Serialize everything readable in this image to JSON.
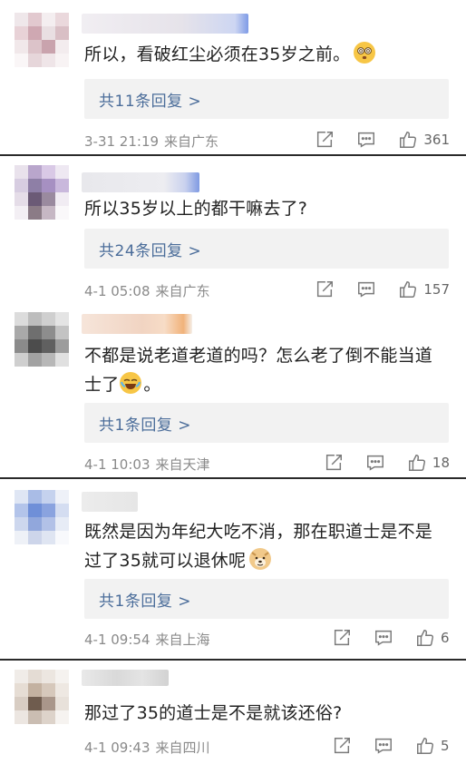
{
  "comments": [
    {
      "text": "所以，看破红尘必须在35岁之前。",
      "emoji": "dizzy-face-emoji",
      "replies": "共11条回复 >",
      "time": "3-31 21:19",
      "source": "来自广东",
      "likes": "361"
    },
    {
      "text": "所以35岁以上的都干嘛去了?",
      "replies": "共24条回复 >",
      "time": "4-1 05:08",
      "source": "来自广东",
      "likes": "157"
    },
    {
      "text_line1": "不都是说老道老道的吗？怎么老了倒不能当道",
      "text_line2": "士了",
      "text_line2_end": "。",
      "emoji": "laugh-cry-emoji",
      "replies": "共1条回复 >",
      "time": "4-1 10:03",
      "source": "来自天津",
      "likes": "18"
    },
    {
      "text_line1": "既然是因为年纪大吃不消，那在职道士是不是",
      "text_line2": "过了35就可以退休呢",
      "emoji": "doge-emoji",
      "replies": "共1条回复 >",
      "time": "4-1 09:54",
      "source": "来自上海",
      "likes": "6"
    },
    {
      "text": "那过了35的道士是不是就该还俗?",
      "time": "4-1 09:43",
      "source": "来自四川",
      "likes": "5"
    }
  ],
  "colors": {
    "link": "#4b6d9a",
    "meta": "#8a8a8a",
    "reply_bg": "#f2f2f2",
    "separator": "#2a2a2a"
  }
}
